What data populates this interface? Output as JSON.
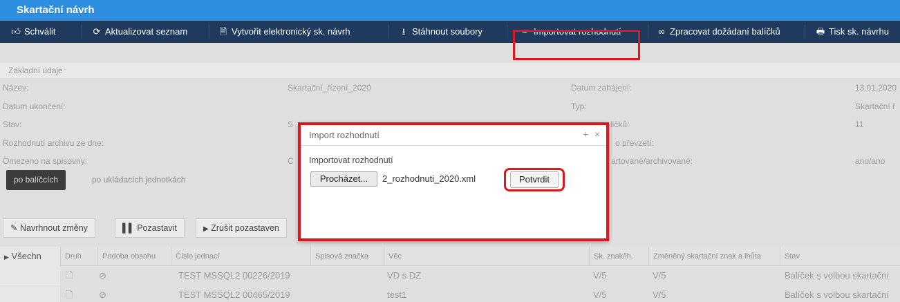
{
  "window": {
    "title": "Skartační návrh"
  },
  "toolbar": {
    "approve": "Schválit",
    "refresh": "Aktualizovat seznam",
    "create_electronic": "Vytvořit elektronický sk. návrh",
    "download": "Stáhnout soubory",
    "import_decision": "Importovat rozhodnutí",
    "process_requested": "Zpracovat dožádaní balíčků",
    "print": "Tisk sk. návrhu"
  },
  "section": {
    "title": "Základní údaje"
  },
  "info": {
    "nazev_label": "Název:",
    "nazev_value": "Skartační_řízení_2020",
    "datum_ukonceni_label": "Datum ukončení:",
    "stav_label": "Stav:",
    "stav_value_partial": "S",
    "rozhodnuti_label": "Rozhodnutí archivu ze dne:",
    "omezeno_label": "Omezeno na spisovny:",
    "omezeno_value_partial": "C",
    "datum_zahajeni_label": "Datum zahájení:",
    "datum_zahajeni_value": "13.01.2020",
    "typ_label": "Typ:",
    "typ_value": "Skartační ř",
    "pocet_label_partial": "ličků:",
    "pocet_value": "11",
    "prevzeti_label_partial": "o převzetí:",
    "skartovane_label_partial": "artované/archivované:",
    "skartovane_value": "ano/ano"
  },
  "subtabs": {
    "active": "po balíčcích",
    "inactive": "po ukládacích jednotkách"
  },
  "actions": {
    "propose": "Navrhnout změny",
    "pause": "Pozastavit",
    "cancel_pause": "Zrušit pozastaven"
  },
  "grid": {
    "group_label": "Všechn",
    "columns": [
      "Druh",
      "Podoba obsahu",
      "Číslo jednací",
      "Spisová značka",
      "Věc",
      "Sk. znak/lh.",
      "Změněný skartační znak a lhůta",
      "Stav"
    ],
    "rows": [
      {
        "cislo": "TEST MSSQL2 00226/2019",
        "vec": "VD s DZ",
        "znak": "V/5",
        "zmeneny": "V/5",
        "stav": "Balíček s volbou skartační"
      },
      {
        "cislo": "TEST MSSQL2 00465/2019",
        "vec": "test1",
        "znak": "V/5",
        "zmeneny": "V/5",
        "stav": "Balíček s volbou skartační"
      }
    ]
  },
  "modal": {
    "title": "Import rozhodnutí",
    "label": "Importovat rozhodnutí",
    "browse": "Procházet...",
    "file": "2_rozhodnuti_2020.xml",
    "confirm": "Potvrdit"
  }
}
